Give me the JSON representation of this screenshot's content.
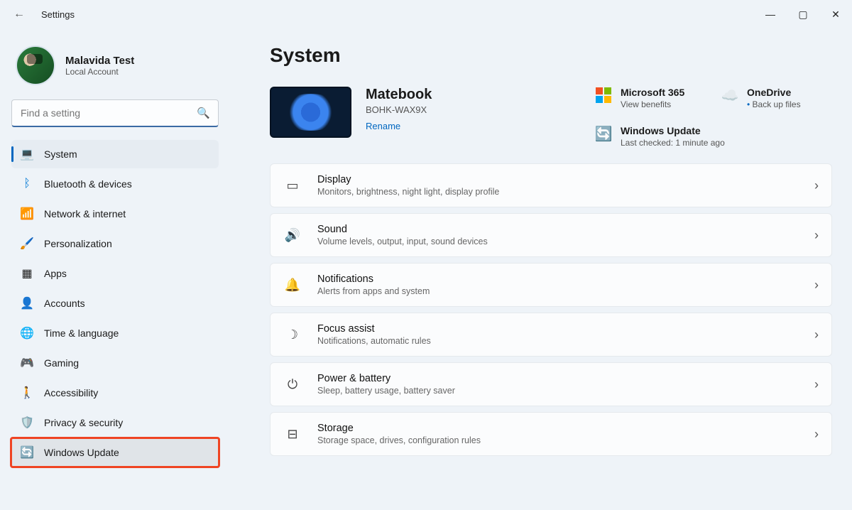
{
  "window": {
    "title": "Settings"
  },
  "account": {
    "name": "Malavida Test",
    "type": "Local Account"
  },
  "search": {
    "placeholder": "Find a setting"
  },
  "sidebar": {
    "items": [
      {
        "label": "System"
      },
      {
        "label": "Bluetooth & devices"
      },
      {
        "label": "Network & internet"
      },
      {
        "label": "Personalization"
      },
      {
        "label": "Apps"
      },
      {
        "label": "Accounts"
      },
      {
        "label": "Time & language"
      },
      {
        "label": "Gaming"
      },
      {
        "label": "Accessibility"
      },
      {
        "label": "Privacy & security"
      },
      {
        "label": "Windows Update"
      }
    ]
  },
  "page": {
    "heading": "System",
    "device": {
      "name": "Matebook",
      "model": "BOHK-WAX9X",
      "rename": "Rename"
    },
    "cloud": {
      "m365": {
        "title": "Microsoft 365",
        "sub": "View benefits"
      },
      "onedrive": {
        "title": "OneDrive",
        "sub": "Back up files"
      },
      "update": {
        "title": "Windows Update",
        "sub": "Last checked: 1 minute ago"
      }
    },
    "cards": [
      {
        "title": "Display",
        "sub": "Monitors, brightness, night light, display profile"
      },
      {
        "title": "Sound",
        "sub": "Volume levels, output, input, sound devices"
      },
      {
        "title": "Notifications",
        "sub": "Alerts from apps and system"
      },
      {
        "title": "Focus assist",
        "sub": "Notifications, automatic rules"
      },
      {
        "title": "Power & battery",
        "sub": "Sleep, battery usage, battery saver"
      },
      {
        "title": "Storage",
        "sub": "Storage space, drives, configuration rules"
      }
    ]
  }
}
